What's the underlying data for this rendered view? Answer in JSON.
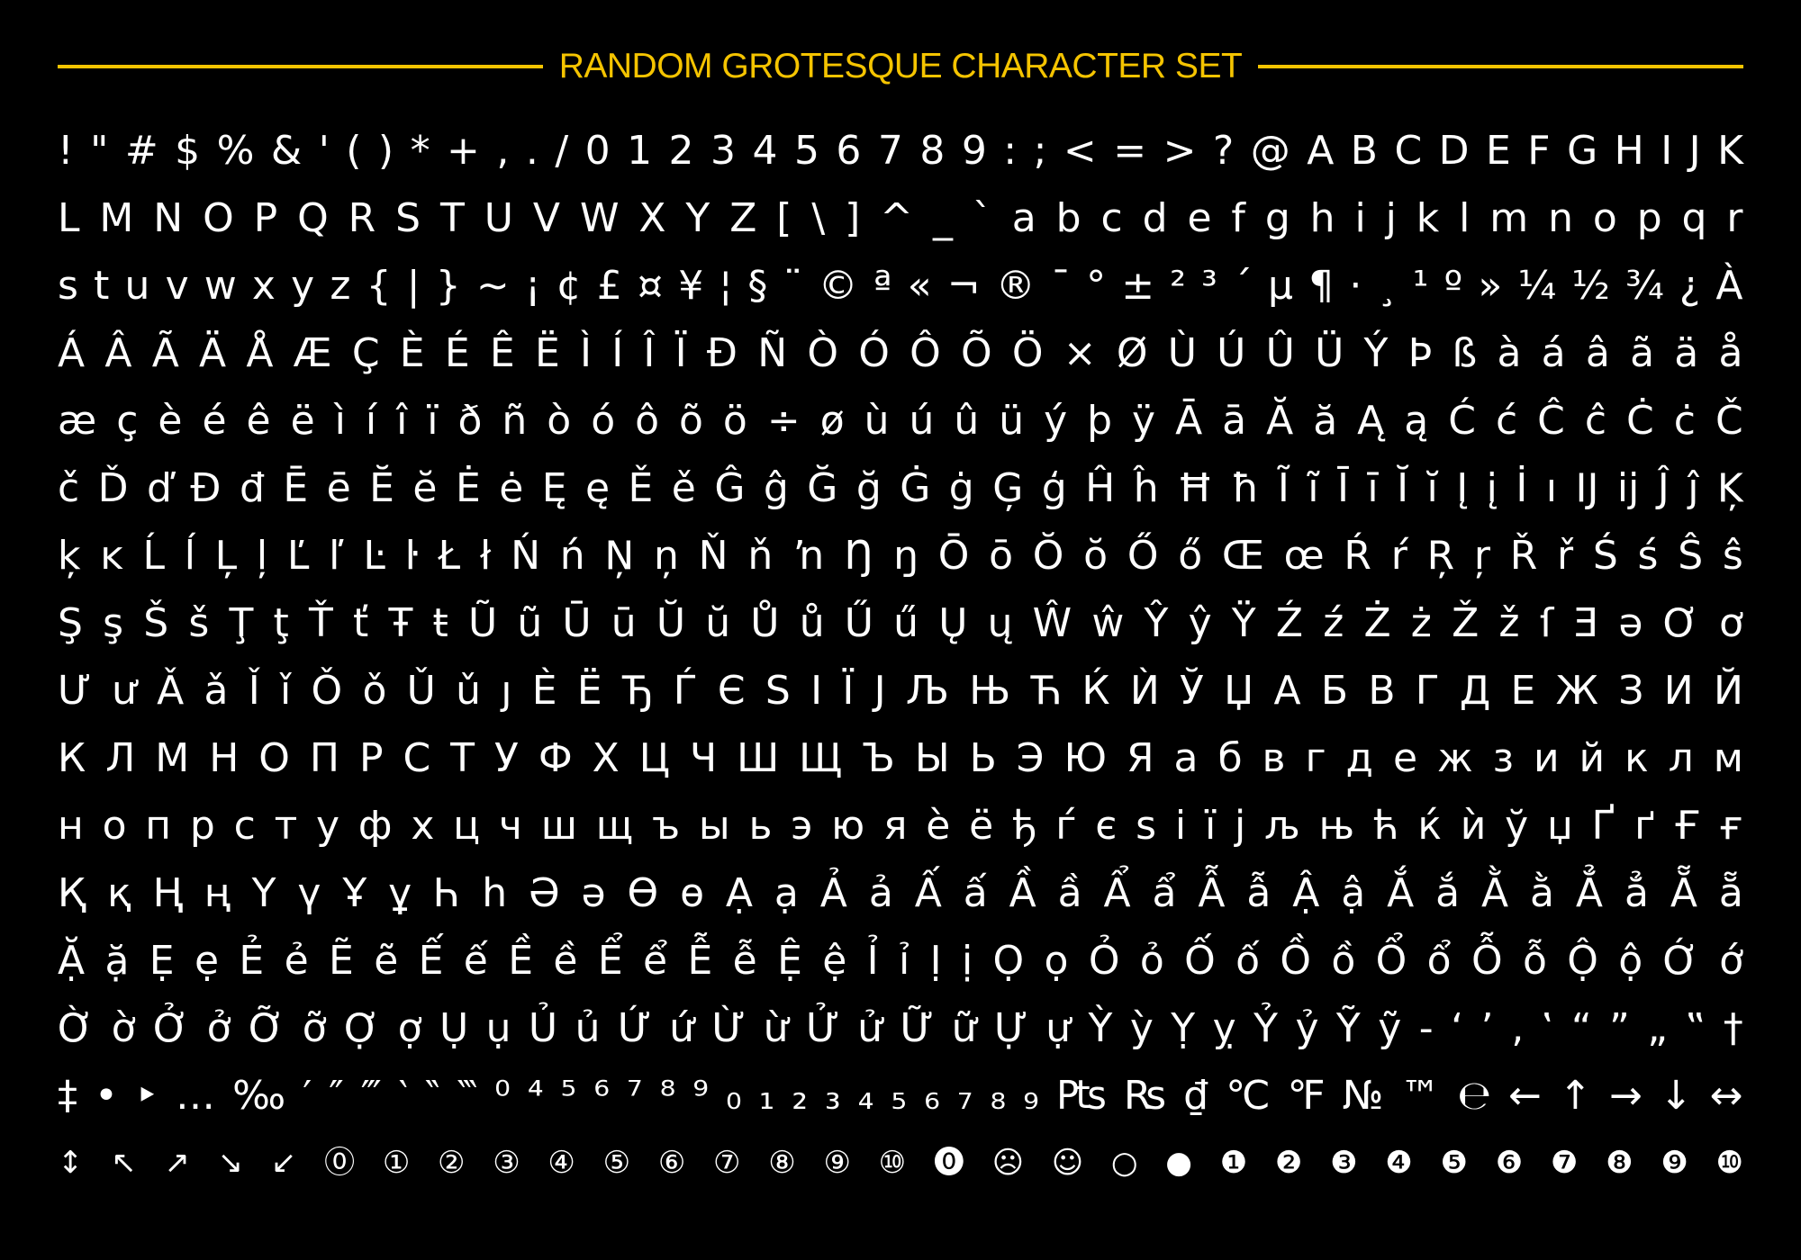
{
  "title": "RANDOM GROTESQUE CHARACTER SET",
  "accent_color": "#f5c400",
  "rows": [
    [
      "!",
      "\"",
      "#",
      "$",
      "%",
      "&",
      "'",
      "(",
      ")",
      "*",
      "+",
      ",",
      ".",
      "/",
      "0",
      "1",
      "2",
      "3",
      "4",
      "5",
      "6",
      "7",
      "8",
      "9",
      ":",
      ";",
      "<",
      "=",
      ">",
      "?",
      "@",
      "A",
      "B",
      "C",
      "D",
      "E",
      "F",
      "G",
      "H",
      "I",
      "J",
      "K"
    ],
    [
      "L",
      "M",
      "N",
      "O",
      "P",
      "Q",
      "R",
      "S",
      "T",
      "U",
      "V",
      "W",
      "X",
      "Y",
      "Z",
      "[",
      "\\",
      "]",
      "^",
      "_",
      "`",
      "a",
      "b",
      "c",
      "d",
      "e",
      "f",
      "g",
      "h",
      "i",
      "j",
      "k",
      "l",
      "m",
      "n",
      "o",
      "p",
      "q",
      "r"
    ],
    [
      "s",
      "t",
      "u",
      "v",
      "w",
      "x",
      "y",
      "z",
      "{",
      "|",
      "}",
      "~",
      "¡",
      "¢",
      "£",
      "¤",
      "¥",
      "¦",
      "§",
      "¨",
      "©",
      "ª",
      "«",
      "¬",
      "®",
      "¯",
      "°",
      "±",
      "²",
      "³",
      "´",
      "µ",
      "¶",
      "·",
      "¸",
      "¹",
      "º",
      "»",
      "¼",
      "½",
      "¾",
      "¿",
      "À"
    ],
    [
      "Á",
      "Â",
      "Ã",
      "Ä",
      "Å",
      "Æ",
      "Ç",
      "È",
      "É",
      "Ê",
      "Ë",
      "Ì",
      "Í",
      "Î",
      "Ï",
      "Ð",
      "Ñ",
      "Ò",
      "Ó",
      "Ô",
      "Õ",
      "Ö",
      "×",
      "Ø",
      "Ù",
      "Ú",
      "Û",
      "Ü",
      "Ý",
      "Þ",
      "ß",
      "à",
      "á",
      "â",
      "ã",
      "ä",
      "å"
    ],
    [
      "æ",
      "ç",
      "è",
      "é",
      "ê",
      "ë",
      "ì",
      "í",
      "î",
      "ï",
      "ð",
      "ñ",
      "ò",
      "ó",
      "ô",
      "õ",
      "ö",
      "÷",
      "ø",
      "ù",
      "ú",
      "û",
      "ü",
      "ý",
      "þ",
      "ÿ",
      "Ā",
      "ā",
      "Ă",
      "ă",
      "Ą",
      "ą",
      "Ć",
      "ć",
      "Ĉ",
      "ĉ",
      "Ċ",
      "ċ",
      "Č"
    ],
    [
      "č",
      "Ď",
      "ď",
      "Đ",
      "đ",
      "Ē",
      "ē",
      "Ĕ",
      "ĕ",
      "Ė",
      "ė",
      "Ę",
      "ę",
      "Ě",
      "ě",
      "Ĝ",
      "ĝ",
      "Ğ",
      "ğ",
      "Ġ",
      "ġ",
      "Ģ",
      "ģ",
      "Ĥ",
      "ĥ",
      "Ħ",
      "ħ",
      "Ĩ",
      "ĩ",
      "Ī",
      "ī",
      "Ĭ",
      "ĭ",
      "Į",
      "į",
      "İ",
      "ı",
      "Ĳ",
      "ĳ",
      "Ĵ",
      "ĵ",
      "Ķ"
    ],
    [
      "ķ",
      "ĸ",
      "Ĺ",
      "ĺ",
      "Ļ",
      "ļ",
      "Ľ",
      "ľ",
      "Ŀ",
      "ŀ",
      "Ł",
      "ł",
      "Ń",
      "ń",
      "Ņ",
      "ņ",
      "Ň",
      "ň",
      "ŉ",
      "Ŋ",
      "ŋ",
      "Ō",
      "ō",
      "Ŏ",
      "ŏ",
      "Ő",
      "ő",
      "Œ",
      "œ",
      "Ŕ",
      "ŕ",
      "Ŗ",
      "ŗ",
      "Ř",
      "ř",
      "Ś",
      "ś",
      "Ŝ",
      "ŝ"
    ],
    [
      "Ş",
      "ş",
      "Š",
      "š",
      "Ţ",
      "ţ",
      "Ť",
      "ť",
      "Ŧ",
      "ŧ",
      "Ũ",
      "ũ",
      "Ū",
      "ū",
      "Ŭ",
      "ŭ",
      "Ů",
      "ů",
      "Ű",
      "ű",
      "Ų",
      "ų",
      "Ŵ",
      "ŵ",
      "Ŷ",
      "ŷ",
      "Ÿ",
      "Ź",
      "ź",
      "Ż",
      "ż",
      "Ž",
      "ž",
      "ſ",
      "Ǝ",
      "ə",
      "Ơ",
      "ơ"
    ],
    [
      "Ư",
      "ư",
      "Ǎ",
      "ǎ",
      "Ǐ",
      "ǐ",
      "Ǒ",
      "ǒ",
      "Ǔ",
      "ǔ",
      "ȷ",
      "Ѐ",
      "Ё",
      "Ђ",
      "Ѓ",
      "Є",
      "Ѕ",
      "І",
      "Ї",
      "Ј",
      "Љ",
      "Њ",
      "Ћ",
      "Ќ",
      "Ѝ",
      "Ў",
      "Џ",
      "А",
      "Б",
      "В",
      "Г",
      "Д",
      "Е",
      "Ж",
      "З",
      "И",
      "Й"
    ],
    [
      "К",
      "Л",
      "М",
      "Н",
      "О",
      "П",
      "Р",
      "С",
      "Т",
      "У",
      "Ф",
      "Х",
      "Ц",
      "Ч",
      "Ш",
      "Щ",
      "Ъ",
      "Ы",
      "Ь",
      "Э",
      "Ю",
      "Я",
      "а",
      "б",
      "в",
      "г",
      "д",
      "е",
      "ж",
      "з",
      "и",
      "й",
      "к",
      "л",
      "м"
    ],
    [
      "н",
      "о",
      "п",
      "р",
      "с",
      "т",
      "у",
      "ф",
      "х",
      "ц",
      "ч",
      "ш",
      "щ",
      "ъ",
      "ы",
      "ь",
      "э",
      "ю",
      "я",
      "ѐ",
      "ё",
      "ђ",
      "ѓ",
      "є",
      "ѕ",
      "і",
      "ї",
      "ј",
      "љ",
      "њ",
      "ћ",
      "ќ",
      "ѝ",
      "ў",
      "џ",
      "Ґ",
      "ґ",
      "Ғ",
      "ғ"
    ],
    [
      "Қ",
      "қ",
      "Ң",
      "ң",
      "Ү",
      "ү",
      "Ұ",
      "ұ",
      "Һ",
      "һ",
      "Ә",
      "ә",
      "Ө",
      "ө",
      "Ạ",
      "ạ",
      "Ả",
      "ả",
      "Ấ",
      "ấ",
      "Ầ",
      "ầ",
      "Ẩ",
      "ẩ",
      "Ẫ",
      "ẫ",
      "Ậ",
      "ậ",
      "Ắ",
      "ắ",
      "Ằ",
      "ằ",
      "Ẳ",
      "ẳ",
      "Ẵ",
      "ẵ"
    ],
    [
      "Ặ",
      "ặ",
      "Ẹ",
      "ẹ",
      "Ẻ",
      "ẻ",
      "Ẽ",
      "ẽ",
      "Ế",
      "ế",
      "Ề",
      "ề",
      "Ể",
      "ể",
      "Ễ",
      "ễ",
      "Ệ",
      "ệ",
      "Ỉ",
      "ỉ",
      "Ị",
      "ị",
      "Ọ",
      "ọ",
      "Ỏ",
      "ỏ",
      "Ố",
      "ố",
      "Ồ",
      "ồ",
      "Ổ",
      "ổ",
      "Ỗ",
      "ỗ",
      "Ộ",
      "ộ",
      "Ớ",
      "ớ"
    ],
    [
      "Ờ",
      "ờ",
      "Ở",
      "ở",
      "Ỡ",
      "ỡ",
      "Ợ",
      "ợ",
      "Ụ",
      "ụ",
      "Ủ",
      "ủ",
      "Ứ",
      "ứ",
      "Ừ",
      "ừ",
      "Ử",
      "ử",
      "Ữ",
      "ữ",
      "Ự",
      "ự",
      "Ỳ",
      "ỳ",
      "Ỵ",
      "ỵ",
      "Ỷ",
      "ỷ",
      "Ỹ",
      "ỹ",
      "-",
      "‘",
      "’",
      "‚",
      "‛",
      "“",
      "”",
      "„",
      "‟",
      "†"
    ],
    [
      "‡",
      "•",
      "‣",
      "…",
      "‰",
      "′",
      "″",
      "‴",
      "‵",
      "‶",
      "‷",
      "⁰",
      "⁴",
      "⁵",
      "⁶",
      "⁷",
      "⁸",
      "⁹",
      "₀",
      "₁",
      "₂",
      "₃",
      "₄",
      "₅",
      "₆",
      "₇",
      "₈",
      "₉",
      "₧",
      "₨",
      "₫",
      "℃",
      "℉",
      "№",
      "™",
      "℮",
      "←",
      "↑",
      "→",
      "↓",
      "↔"
    ],
    [
      "↕",
      "↖",
      "↗",
      "↘",
      "↙",
      "⓪",
      "①",
      "②",
      "③",
      "④",
      "⑤",
      "⑥",
      "⑦",
      "⑧",
      "⑨",
      "⑩",
      "⓿",
      "☹",
      "☺",
      "○",
      "●",
      "❶",
      "❷",
      "❸",
      "❹",
      "❺",
      "❻",
      "❼",
      "❽",
      "❾",
      "❿"
    ]
  ]
}
